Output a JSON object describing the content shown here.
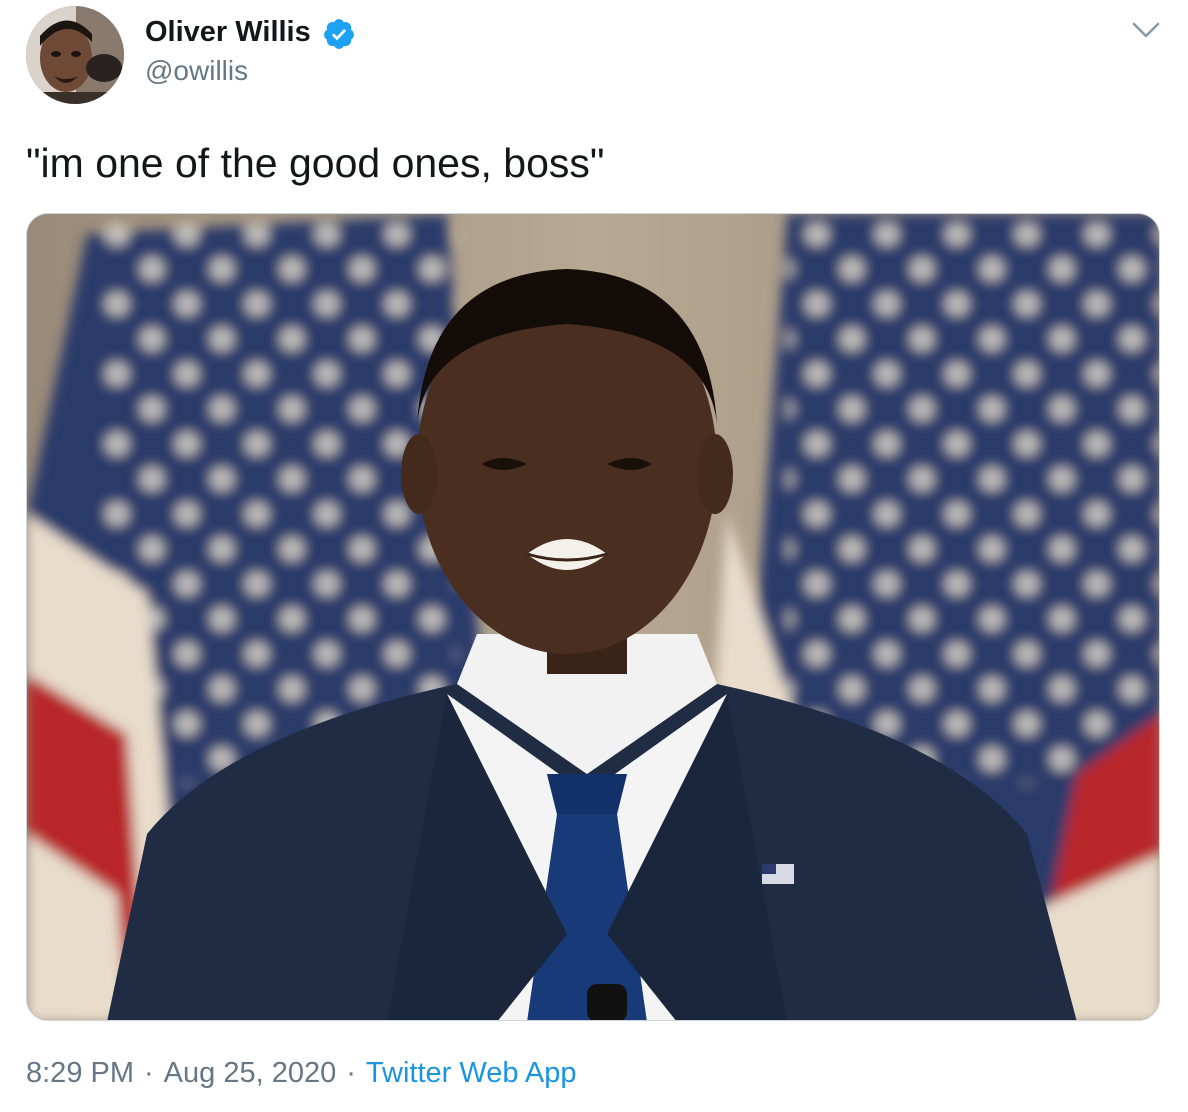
{
  "tweet": {
    "author_name": "Oliver Willis",
    "author_handle": "@owillis",
    "text": "\"im one of the good ones, boss\"",
    "time": "8:29 PM",
    "date": "Aug 25, 2020",
    "separator": "·",
    "source": "Twitter Web App"
  },
  "icons": {
    "verified": "verified-badge-icon",
    "menu": "chevron-down-icon"
  },
  "colors": {
    "text": "#14171a",
    "secondary": "#657786",
    "link": "#1b95e0",
    "verified": "#1da1f2",
    "border": "#ccd6dd"
  }
}
